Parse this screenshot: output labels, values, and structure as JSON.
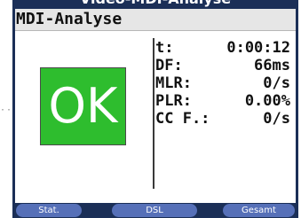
{
  "window": {
    "title": "Video-MDI-Analyse"
  },
  "screen": {
    "heading": "MDI-Analyse"
  },
  "status": {
    "label": "OK",
    "color": "#2ebd2e"
  },
  "stats": [
    {
      "label": "t:",
      "value": "0:00:12"
    },
    {
      "label": "DF:",
      "value": "66ms"
    },
    {
      "label": "MLR:",
      "value": "0/s"
    },
    {
      "label": "PLR:",
      "value": "0.00%"
    },
    {
      "label": "CC F.:",
      "value": "0/s"
    }
  ],
  "softkeys": [
    "Stat.",
    "DSL",
    "Gesamt"
  ],
  "side_marker": "··"
}
